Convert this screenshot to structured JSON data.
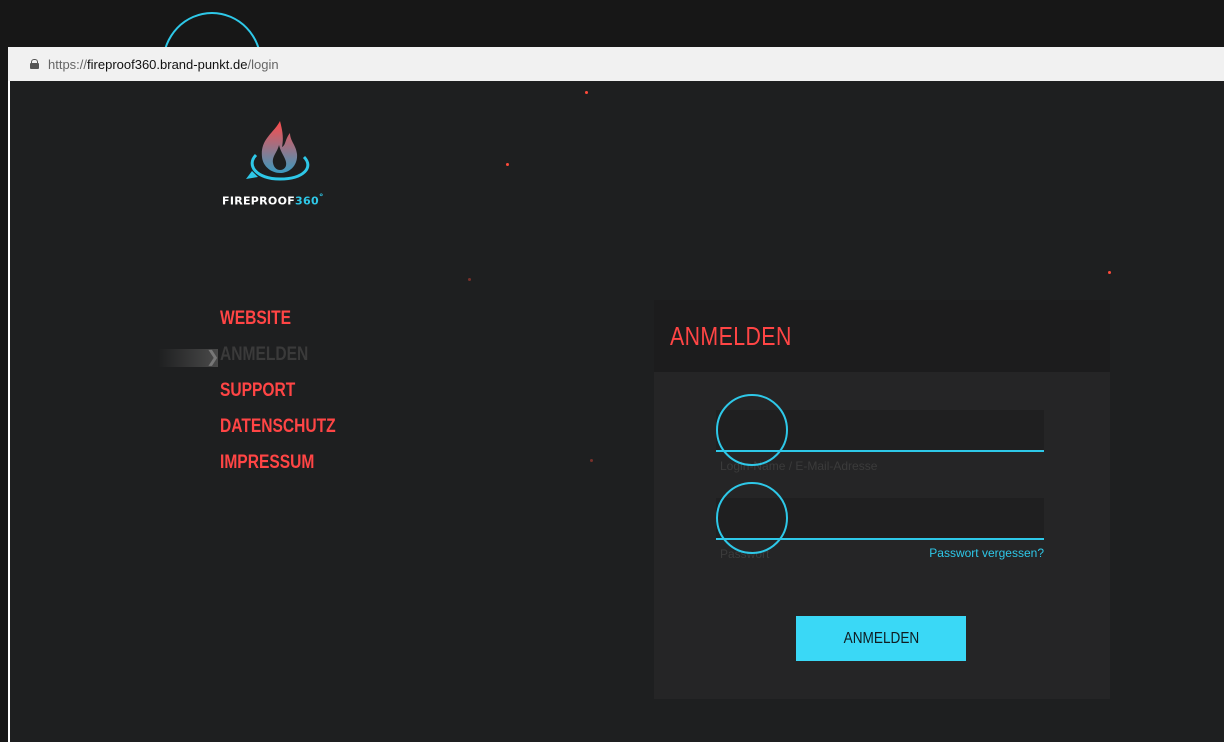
{
  "browser": {
    "url_scheme": "https://",
    "url_host": "fireproof360.brand-punkt.de",
    "url_path": "/login"
  },
  "logo": {
    "word_main": "FIREPROOF",
    "word_accent": "360",
    "mark": "°",
    "icon": "flame-360-icon"
  },
  "nav": {
    "items": [
      {
        "label": "WEBSITE",
        "active": false
      },
      {
        "label": "ANMELDEN",
        "active": true
      },
      {
        "label": "SUPPORT",
        "active": false
      },
      {
        "label": "DATENSCHUTZ",
        "active": false
      },
      {
        "label": "IMPRESSUM",
        "active": false
      }
    ]
  },
  "login": {
    "title": "ANMELDEN",
    "username_label": "Login-Name / E-Mail-Adresse",
    "username_value": "",
    "password_label": "Passwort",
    "password_value": "",
    "forgot_label": "Passwort vergessen?",
    "submit_label": "ANMELDEN"
  },
  "colors": {
    "accent_red": "#ff4545",
    "accent_cyan": "#2ec8e8",
    "button_cyan": "#3ad8f6",
    "background": "#1e1f20"
  }
}
